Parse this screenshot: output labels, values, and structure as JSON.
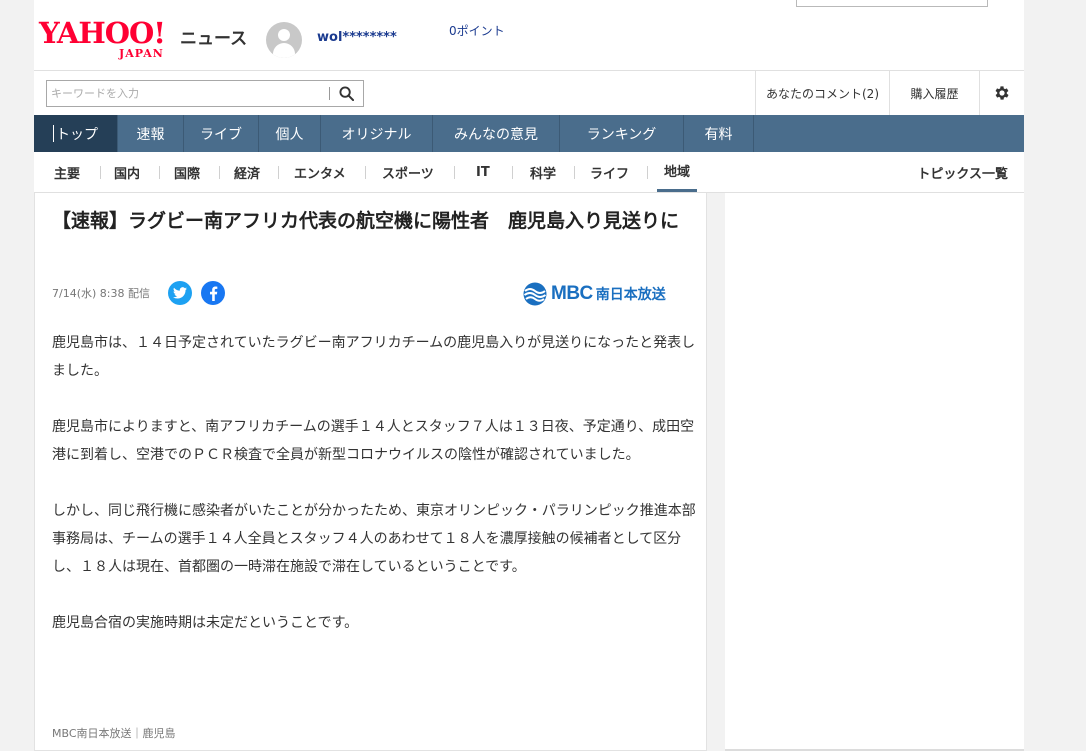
{
  "header": {
    "logo_text": "YAHOO!",
    "logo_sub": "JAPAN",
    "service_name": "ニュース",
    "username": "wol********",
    "points": "0ポイント"
  },
  "search": {
    "placeholder": "キーワードを入力",
    "value": ""
  },
  "toolbar": {
    "comments": "あなたのコメント(2)",
    "history": "購入履歴"
  },
  "main_nav": [
    {
      "label": "トップ",
      "active": true
    },
    {
      "label": "速報"
    },
    {
      "label": "ライブ"
    },
    {
      "label": "個人"
    },
    {
      "label": "オリジナル"
    },
    {
      "label": "みんなの意見"
    },
    {
      "label": "ランキング"
    },
    {
      "label": "有料"
    }
  ],
  "sub_nav": [
    {
      "label": "主要"
    },
    {
      "label": "国内"
    },
    {
      "label": "国際"
    },
    {
      "label": "経済"
    },
    {
      "label": "エンタメ"
    },
    {
      "label": "スポーツ"
    },
    {
      "label": "IT"
    },
    {
      "label": "科学"
    },
    {
      "label": "ライフ"
    },
    {
      "label": "地域",
      "active": true
    }
  ],
  "sub_nav_right": "トピックス一覧",
  "article": {
    "title": "【速報】ラグビー南アフリカ代表の航空機に陽性者　鹿児島入り見送りに",
    "date": "7/14(水) 8:38",
    "date_suffix": "配信",
    "provider_mbc": "MBC",
    "provider_jp": "南日本放送",
    "paragraphs": [
      "鹿児島市は、１４日予定されていたラグビー南アフリカチームの鹿児島入りが見送りになったと発表しました。",
      "鹿児島市によりますと、南アフリカチームの選手１４人とスタッフ７人は１３日夜、予定通り、成田空港に到着し、空港でのＰＣＲ検査で全員が新型コロナウイルスの陰性が確認されていました。",
      "しかし、同じ飛行機に感染者がいたことが分かったため、東京オリンピック・パラリンピック推進本部事務局は、チームの選手１４人全員とスタッフ４人のあわせて１８人を濃厚接触の候補者として区分し、１８人は現在、首都圏の一時滞在施設で滞在しているということです。",
      "鹿児島合宿の実施時期は未定だということです。"
    ],
    "source": "MBC南日本放送｜鹿児島"
  },
  "colors": {
    "brand_red": "#ff0033",
    "nav_bg": "#4a6d8c",
    "nav_active": "#253f57",
    "twitter": "#1da1f2",
    "facebook": "#1877f2",
    "mbc_blue": "#1a6fc0"
  }
}
